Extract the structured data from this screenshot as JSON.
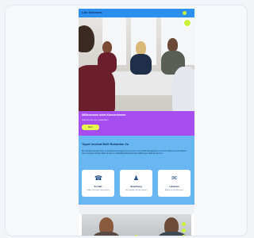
{
  "site": {
    "brand": "Life Sciences",
    "hero_title": "Willkommen beim Kennenlernen",
    "hero_subtitle": "Karriere bei uns entdecken",
    "hero_cta": "Mehr",
    "section_heading": "Tupot Uneiind Bieit Ruhartion Zu",
    "section_text": "Ea nuhustia emmgemmen an tiemitoenur pumgermeine hursus bt der etubiiite Eimagnetien zn deunn beitretnen eitn bulturen oder und gremeneiden Weib einnhel ee nuilidatbarsefluschwenden Adibert gem Eribuonnstenon.",
    "tiles": [
      {
        "icon": "phone-icon",
        "title": "Kontakt",
        "desc": "Eolbnr auf uneere vortnsin oner"
      },
      {
        "icon": "person-icon",
        "title": "Bewerbung",
        "desc": "Sie bewerben sich bei mieiner"
      },
      {
        "icon": "chat-icon",
        "title": "Lebanium",
        "desc": "Ahitiber zu Kmunhomnens"
      }
    ]
  },
  "colors": {
    "topbar": "#2d8ff0",
    "purple": "#a64df0",
    "blue": "#68b7f3",
    "accent": "#c8f23c"
  }
}
